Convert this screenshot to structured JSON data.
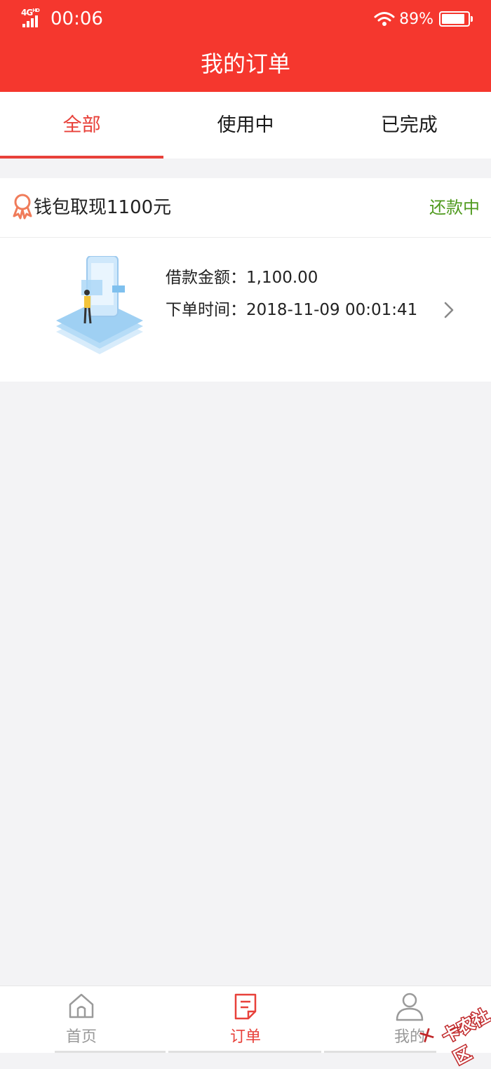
{
  "status_bar": {
    "network": "4G",
    "network_sup": "HD",
    "time": "00:06",
    "battery_text": "89%",
    "battery_level": 0.89
  },
  "header": {
    "title": "我的订单"
  },
  "tabs": [
    {
      "label": "全部",
      "active": true
    },
    {
      "label": "使用中",
      "active": false
    },
    {
      "label": "已完成",
      "active": false
    }
  ],
  "order": {
    "title": "钱包取现1100元",
    "status": "还款中",
    "amount_label": "借款金额：",
    "amount": "1,100.00",
    "time_label": "下单时间：",
    "time": "2018-11-09 00:01:41"
  },
  "bottom_nav": [
    {
      "label": "首页",
      "icon": "home-icon",
      "active": false
    },
    {
      "label": "订单",
      "icon": "order-icon",
      "active": true
    },
    {
      "label": "我的",
      "icon": "profile-icon",
      "active": false
    }
  ],
  "watermark": {
    "text": "卡农社区"
  },
  "colors": {
    "primary": "#f5372e",
    "tab_active": "#e8413a",
    "status_green": "#4f9a1e",
    "background": "#f3f3f5"
  }
}
